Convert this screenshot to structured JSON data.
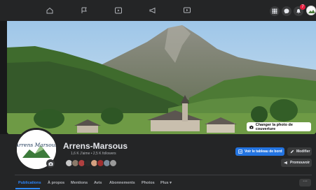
{
  "page": {
    "name": "Arrens-Marsous",
    "stats": "1,6 K J'aime • 2,5 K followers"
  },
  "avatar_logo_text": "Arrens Marsous",
  "cover": {
    "change_label": "Changer la photo de couverture"
  },
  "actions": {
    "dashboard": "Voir le tableau de bord",
    "edit": "Modifier",
    "promote": "Promouvoir"
  },
  "tabs": [
    "Publications",
    "À propos",
    "Mentions",
    "Avis",
    "Abonnements",
    "Photos",
    "Plus ▾"
  ],
  "more_label": "···",
  "notifications": {
    "count": "7"
  },
  "colors": {
    "accent": "#2374e1",
    "tab_active": "#2d88ff",
    "background": "#18191a",
    "surface": "#242526"
  },
  "icons": {
    "nav": [
      "home-icon",
      "flag-icon",
      "video-icon",
      "megaphone-icon",
      "play-icon"
    ],
    "right": [
      "menu-grid-icon",
      "messenger-icon",
      "bell-icon",
      "profile-avatar"
    ]
  }
}
